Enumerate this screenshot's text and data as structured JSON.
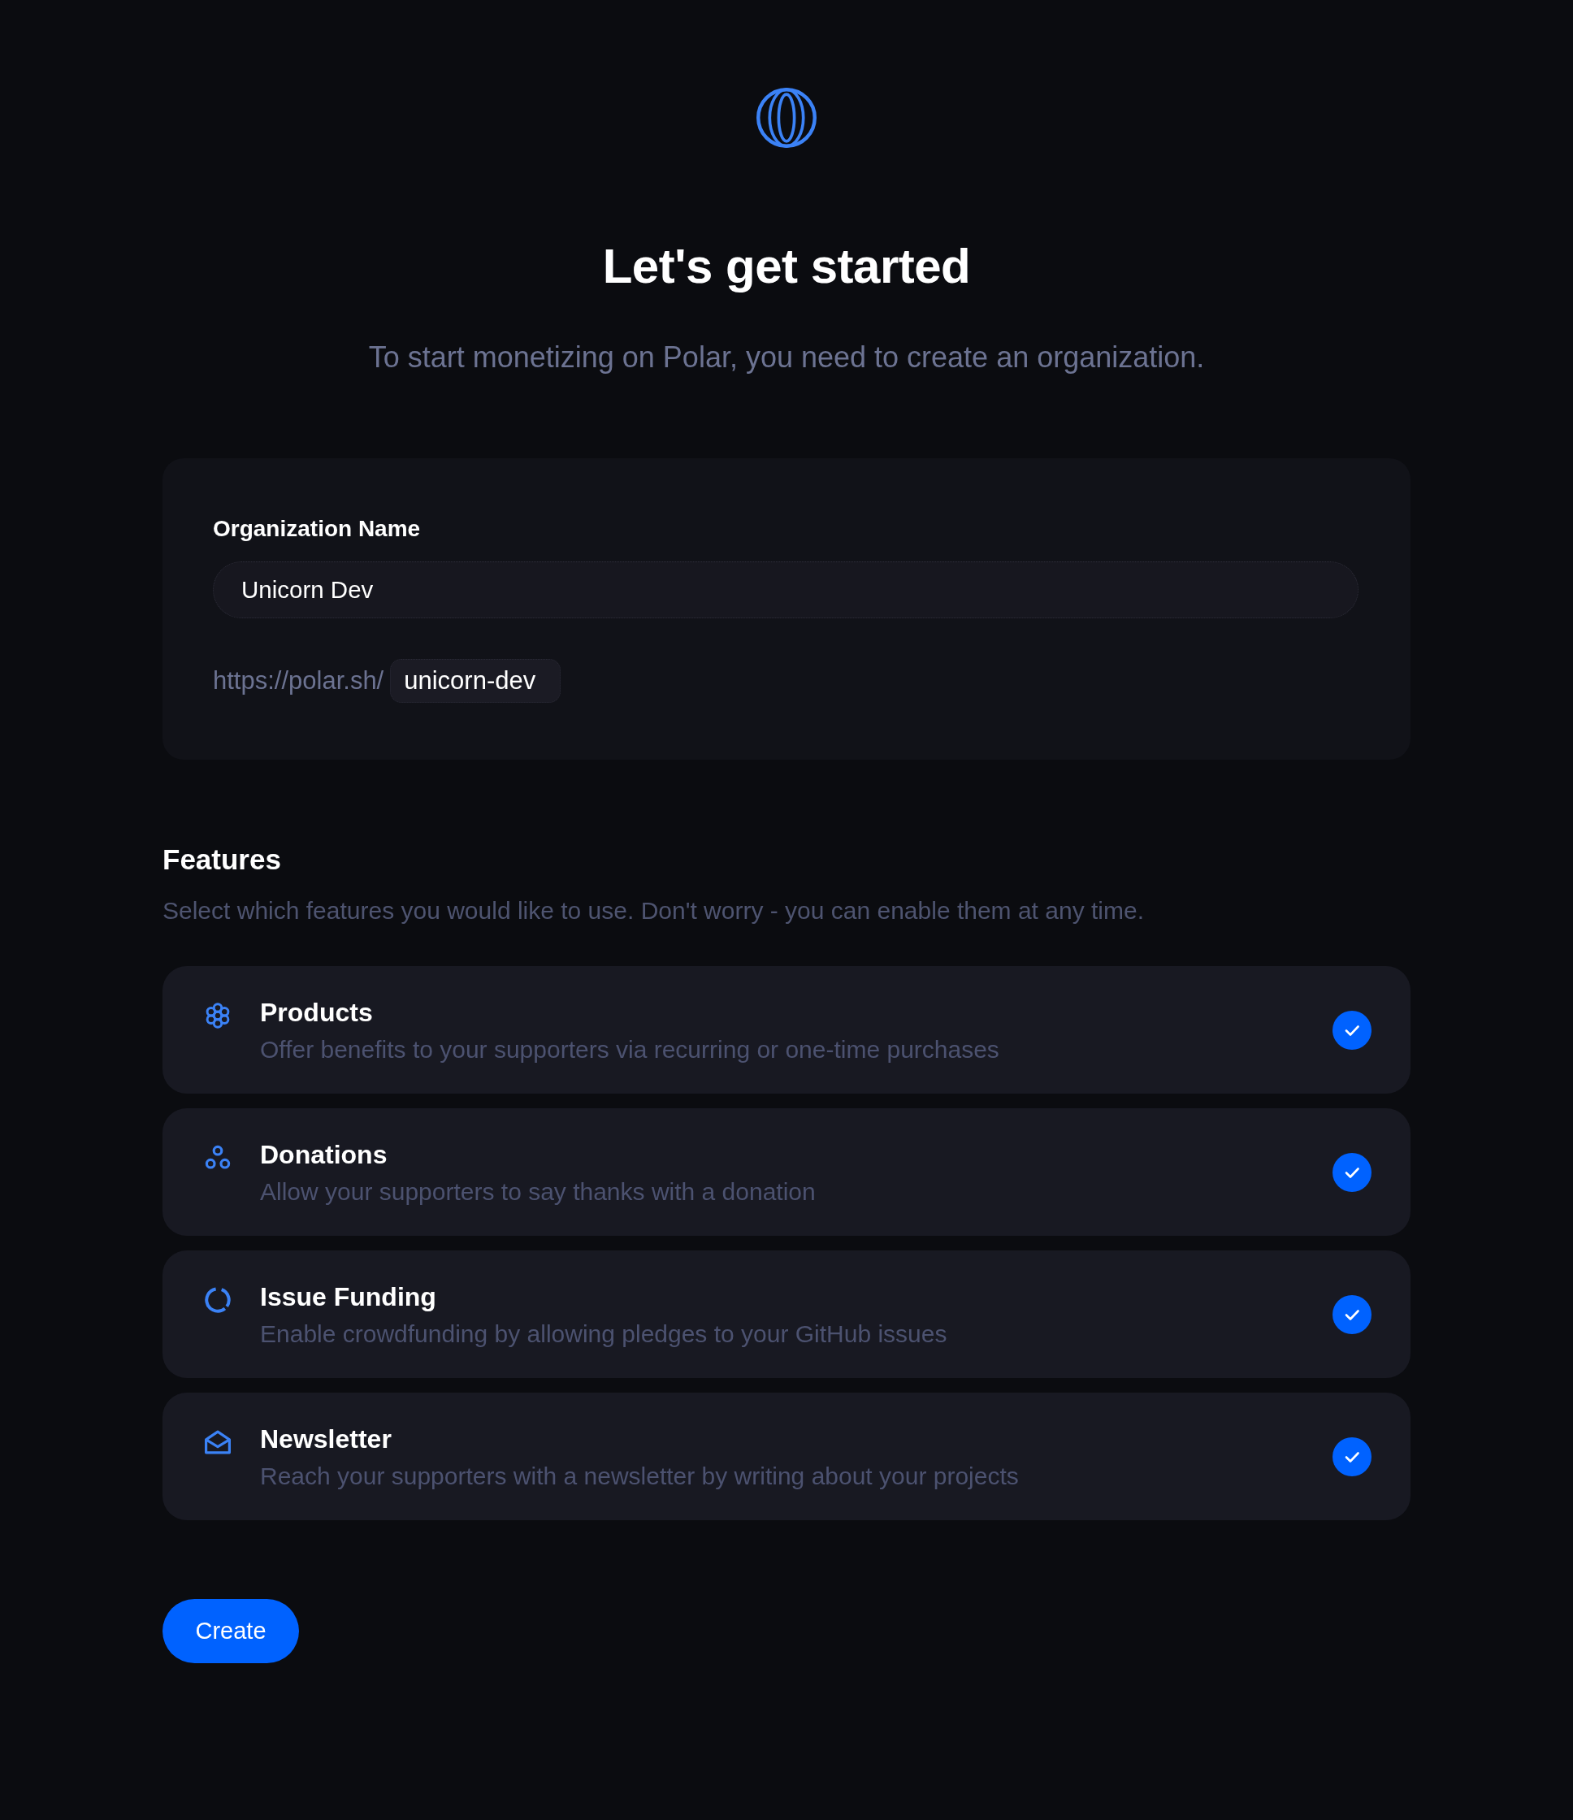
{
  "heading": {
    "title": "Let's get started",
    "subtitle": "To start monetizing on Polar, you need to create an organization."
  },
  "organization": {
    "label": "Organization Name",
    "name_value": "Unicorn Dev",
    "url_prefix": "https://polar.sh/",
    "slug_value": "unicorn-dev"
  },
  "features": {
    "title": "Features",
    "description": "Select which features you would like to use. Don't worry - you can enable them at any time.",
    "items": [
      {
        "kind": "products",
        "title": "Products",
        "description": "Offer benefits to your supporters via recurring or one-time purchases",
        "checked": true
      },
      {
        "kind": "donations",
        "title": "Donations",
        "description": "Allow your supporters to say thanks with a donation",
        "checked": true
      },
      {
        "kind": "funding",
        "title": "Issue Funding",
        "description": "Enable crowdfunding by allowing pledges to your GitHub issues",
        "checked": true
      },
      {
        "kind": "newsletter",
        "title": "Newsletter",
        "description": "Reach your supporters with a newsletter by writing about your projects",
        "checked": true
      }
    ]
  },
  "create_button": {
    "label": "Create"
  }
}
